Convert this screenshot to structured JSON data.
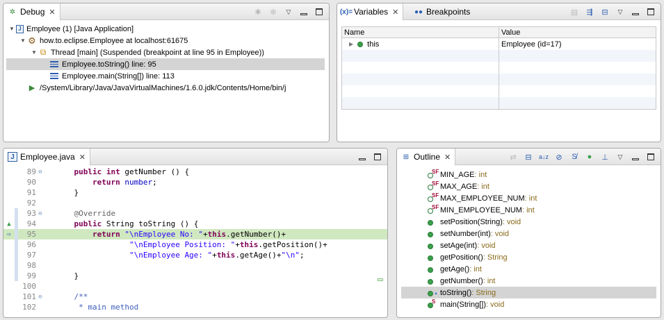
{
  "debug": {
    "tab_label": "Debug",
    "tree": [
      {
        "text": "Employee (1) [Java Application]",
        "indent": 0,
        "icon": "java-app-icon",
        "twisty": "open"
      },
      {
        "text": "how.to.eclipse.Employee at localhost:61675",
        "indent": 1,
        "icon": "debug-target-icon",
        "twisty": "open"
      },
      {
        "text": "Thread [main] (Suspended (breakpoint at line 95 in Employee))",
        "indent": 2,
        "icon": "thread-icon",
        "twisty": "open"
      },
      {
        "text": "Employee.toString() line: 95",
        "indent": 3,
        "icon": "stack-frame-icon",
        "twisty": "",
        "selected": true
      },
      {
        "text": "Employee.main(String[]) line: 113",
        "indent": 3,
        "icon": "stack-frame-icon",
        "twisty": ""
      },
      {
        "text": "/System/Library/Java/JavaVirtualMachines/1.6.0.jdk/Contents/Home/bin/j",
        "indent": 1,
        "icon": "process-icon",
        "twisty": ""
      }
    ]
  },
  "variables": {
    "tab_label": "Variables",
    "breakpoints_tab_label": "Breakpoints",
    "col_name": "Name",
    "col_value": "Value",
    "rows": [
      {
        "name": "this",
        "value": "Employee  (id=17)"
      }
    ]
  },
  "editor": {
    "tab_label": "Employee.java",
    "lines": [
      {
        "num": "89",
        "fold": "⊖",
        "marker": "",
        "changed": false,
        "current": false
      },
      {
        "num": "90",
        "fold": "",
        "marker": "",
        "changed": false,
        "current": false
      },
      {
        "num": "91",
        "fold": "",
        "marker": "",
        "changed": false,
        "current": false
      },
      {
        "num": "92",
        "fold": "",
        "marker": "",
        "changed": false,
        "current": false
      },
      {
        "num": "93",
        "fold": "⊖",
        "marker": "",
        "changed": true,
        "current": false
      },
      {
        "num": "94",
        "fold": "",
        "marker": "override",
        "changed": true,
        "current": false
      },
      {
        "num": "95",
        "fold": "",
        "marker": "breakpoint",
        "changed": true,
        "current": true
      },
      {
        "num": "96",
        "fold": "",
        "marker": "",
        "changed": true,
        "current": false
      },
      {
        "num": "97",
        "fold": "",
        "marker": "",
        "changed": true,
        "current": false
      },
      {
        "num": "98",
        "fold": "",
        "marker": "",
        "changed": true,
        "current": false
      },
      {
        "num": "99",
        "fold": "",
        "marker": "",
        "changed": true,
        "current": false
      },
      {
        "num": "100",
        "fold": "",
        "marker": "",
        "changed": false,
        "current": false
      },
      {
        "num": "101",
        "fold": "⊖",
        "marker": "",
        "changed": false,
        "current": false
      },
      {
        "num": "102",
        "fold": "",
        "marker": "",
        "changed": false,
        "current": false
      }
    ],
    "code": [
      [
        {
          "t": "    "
        },
        {
          "t": "public int",
          "c": "kw"
        },
        {
          "t": " getNumber () {"
        }
      ],
      [
        {
          "t": "        "
        },
        {
          "t": "return",
          "c": "kw"
        },
        {
          "t": " "
        },
        {
          "t": "number",
          "c": "fld"
        },
        {
          "t": ";"
        }
      ],
      [
        {
          "t": "    }"
        }
      ],
      [
        {
          "t": ""
        }
      ],
      [
        {
          "t": "    "
        },
        {
          "t": "@Override",
          "c": "ann"
        }
      ],
      [
        {
          "t": "    "
        },
        {
          "t": "public",
          "c": "kw"
        },
        {
          "t": " String toString () {"
        }
      ],
      [
        {
          "t": "        "
        },
        {
          "t": "return",
          "c": "kw"
        },
        {
          "t": " "
        },
        {
          "t": "\"\\nEmployee No: \"",
          "c": "str"
        },
        {
          "t": "+"
        },
        {
          "t": "this",
          "c": "kw"
        },
        {
          "t": ".getNumber()+"
        }
      ],
      [
        {
          "t": "                "
        },
        {
          "t": "\"\\nEmployee Position: \"",
          "c": "str"
        },
        {
          "t": "+"
        },
        {
          "t": "this",
          "c": "kw"
        },
        {
          "t": ".getPosition()+"
        }
      ],
      [
        {
          "t": "                "
        },
        {
          "t": "\"\\nEmployee Age: \"",
          "c": "str"
        },
        {
          "t": "+"
        },
        {
          "t": "this",
          "c": "kw"
        },
        {
          "t": ".getAge()+"
        },
        {
          "t": "\"\\n\"",
          "c": "str"
        },
        {
          "t": ";"
        }
      ],
      [
        {
          "t": ""
        }
      ],
      [
        {
          "t": "    }"
        }
      ],
      [
        {
          "t": ""
        }
      ],
      [
        {
          "t": "    "
        },
        {
          "t": "/**",
          "c": "cmt"
        }
      ],
      [
        {
          "t": "     "
        },
        {
          "t": "* main method",
          "c": "cmt"
        }
      ]
    ]
  },
  "outline": {
    "tab_label": "Outline",
    "items": [
      {
        "name": "MIN_AGE",
        "type": " : int",
        "kind": "static-final-field"
      },
      {
        "name": "MAX_AGE",
        "type": " : int",
        "kind": "static-final-field"
      },
      {
        "name": "MAX_EMPLOYEE_NUM",
        "type": " : int",
        "kind": "static-final-field"
      },
      {
        "name": "MIN_EMPLOYEE_NUM",
        "type": " : int",
        "kind": "static-final-field"
      },
      {
        "name": "setPosition(String)",
        "type": " : void",
        "kind": "public-method"
      },
      {
        "name": "setNumber(int)",
        "type": " : void",
        "kind": "public-method"
      },
      {
        "name": "setAge(int)",
        "type": " : void",
        "kind": "public-method"
      },
      {
        "name": "getPosition()",
        "type": " : String",
        "kind": "public-method"
      },
      {
        "name": "getAge()",
        "type": " : int",
        "kind": "public-method"
      },
      {
        "name": "getNumber()",
        "type": " : int",
        "kind": "public-method"
      },
      {
        "name": "toString()",
        "type": " : String",
        "kind": "override-method",
        "selected": true
      },
      {
        "name": "main(String[])",
        "type": " : void",
        "kind": "static-method"
      }
    ]
  },
  "colors": {
    "current_line": "#d0e8c0",
    "selection": "#d4d4d4",
    "keyword": "#7f0055",
    "string": "#2a00ff"
  }
}
